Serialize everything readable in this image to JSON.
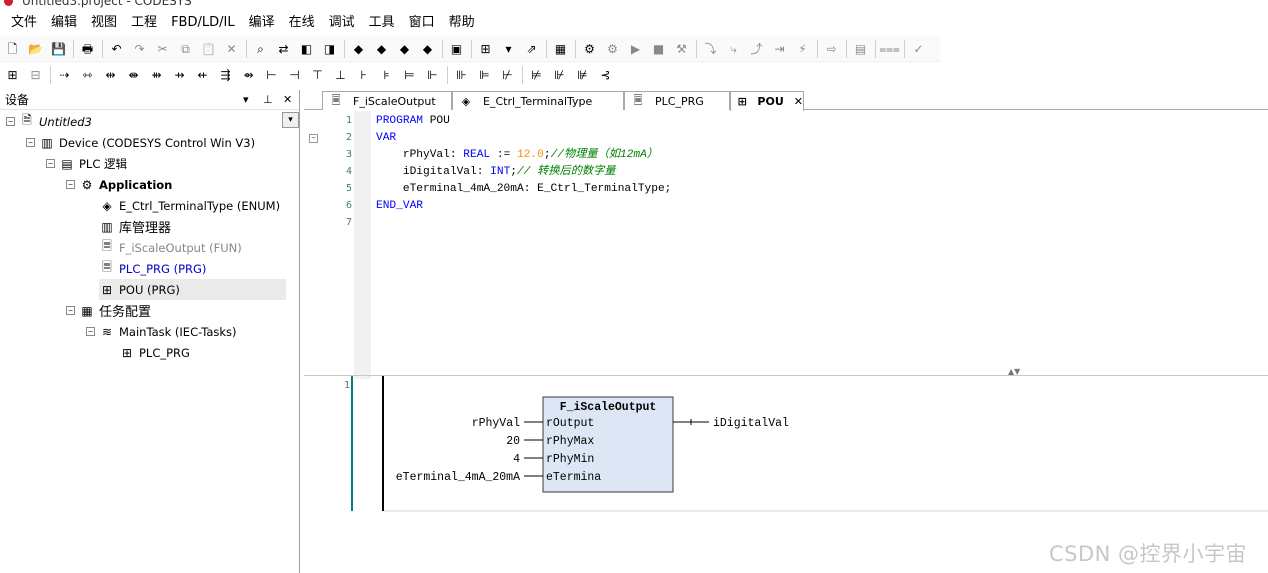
{
  "window": {
    "title": "Untitled3.project - CODESYS"
  },
  "menu": [
    "文件",
    "编辑",
    "视图",
    "工程",
    "FBD/LD/IL",
    "编译",
    "在线",
    "调试",
    "工具",
    "窗口",
    "帮助"
  ],
  "toolbar1": [
    {
      "icon": "new-file-icon",
      "glyph": "🗋"
    },
    {
      "icon": "open-folder-icon",
      "glyph": "📂"
    },
    {
      "icon": "save-icon",
      "glyph": "💾"
    },
    {
      "sep": true
    },
    {
      "icon": "print-icon",
      "glyph": "🖶"
    },
    {
      "sep": true
    },
    {
      "icon": "undo-icon",
      "glyph": "↶"
    },
    {
      "icon": "redo-icon",
      "glyph": "↷",
      "dis": true
    },
    {
      "icon": "cut-icon",
      "glyph": "✂",
      "dis": true
    },
    {
      "icon": "copy-icon",
      "glyph": "⧉",
      "dis": true
    },
    {
      "icon": "paste-icon",
      "glyph": "📋",
      "dis": true
    },
    {
      "icon": "delete-icon",
      "glyph": "✕",
      "dis": true
    },
    {
      "sep": true
    },
    {
      "icon": "find-icon",
      "glyph": "⌕"
    },
    {
      "icon": "find-replace-icon",
      "glyph": "⇄"
    },
    {
      "icon": "find-prev-icon",
      "glyph": "◧"
    },
    {
      "icon": "find-next-icon",
      "glyph": "◨"
    },
    {
      "sep": true
    },
    {
      "icon": "breakpoint-icon",
      "glyph": "◆"
    },
    {
      "icon": "breakpoint-add-icon",
      "glyph": "◆"
    },
    {
      "icon": "breakpoint-toggle-icon",
      "glyph": "◆"
    },
    {
      "icon": "breakpoint-remove-icon",
      "glyph": "◆"
    },
    {
      "sep": true
    },
    {
      "icon": "window-icon",
      "glyph": "▣"
    },
    {
      "sep": true
    },
    {
      "icon": "add-object-icon",
      "glyph": "⊞"
    },
    {
      "icon": "dropdown-icon",
      "glyph": "▾"
    },
    {
      "icon": "export-icon",
      "glyph": "⇗"
    },
    {
      "sep": true
    },
    {
      "icon": "build-icon",
      "glyph": "▦"
    },
    {
      "sep": true
    },
    {
      "icon": "login-icon",
      "glyph": "⚙"
    },
    {
      "icon": "logout-icon",
      "glyph": "⚙",
      "dis": true
    },
    {
      "icon": "start-icon",
      "glyph": "▶",
      "dis": true
    },
    {
      "icon": "stop-icon",
      "glyph": "■",
      "dis": true
    },
    {
      "icon": "reset-icon",
      "glyph": "⚒",
      "dis": true
    },
    {
      "sep": true
    },
    {
      "icon": "step-over-icon",
      "glyph": "⤵",
      "dis": true
    },
    {
      "icon": "step-into-icon",
      "glyph": "⤷",
      "dis": true
    },
    {
      "icon": "step-out-icon",
      "glyph": "⤴",
      "dis": true
    },
    {
      "icon": "run-to-cursor-icon",
      "glyph": "⇥",
      "dis": true
    },
    {
      "icon": "flow-control-icon",
      "glyph": "⚡",
      "dis": true
    },
    {
      "sep": true
    },
    {
      "icon": "next-statement-icon",
      "glyph": "⇨",
      "dis": true
    },
    {
      "sep": true
    },
    {
      "icon": "write-values-icon",
      "glyph": "▤",
      "dis": true
    },
    {
      "sep": true
    },
    {
      "icon": "force-values-icon",
      "glyph": "⩶",
      "dis": true
    },
    {
      "sep": true
    },
    {
      "icon": "unforce-icon",
      "glyph": "✓",
      "dis": true
    }
  ],
  "toolbar2": [
    {
      "icon": "insert-network-icon",
      "glyph": "⊞"
    },
    {
      "icon": "insert-network-below-icon",
      "glyph": "⊟",
      "dis": true
    },
    {
      "sep": true
    },
    {
      "icon": "insert-variable-icon",
      "glyph": "⇢"
    },
    {
      "icon": "insert-contact-icon",
      "glyph": "⇿"
    },
    {
      "icon": "insert-negated-contact-icon",
      "glyph": "⇹"
    },
    {
      "icon": "insert-parallel-icon",
      "glyph": "⇼"
    },
    {
      "icon": "insert-coil-icon",
      "glyph": "⇻"
    },
    {
      "icon": "insert-set-coil-icon",
      "glyph": "⇸"
    },
    {
      "icon": "insert-reset-coil-icon",
      "glyph": "⇷"
    },
    {
      "icon": "insert-box-icon",
      "glyph": "⇶"
    },
    {
      "icon": "insert-empty-box-icon",
      "glyph": "⇴"
    },
    {
      "icon": "insert-input-icon",
      "glyph": "⊢"
    },
    {
      "icon": "insert-output-icon",
      "glyph": "⊣"
    },
    {
      "icon": "insert-assignment-icon",
      "glyph": "⊤"
    },
    {
      "icon": "insert-jump-icon",
      "glyph": "⊥"
    },
    {
      "icon": "insert-label-icon",
      "glyph": "⊦"
    },
    {
      "icon": "insert-return-icon",
      "glyph": "⊧"
    },
    {
      "icon": "insert-branch-icon",
      "glyph": "⊨"
    },
    {
      "icon": "set-output-icon",
      "glyph": "⊩"
    },
    {
      "sep": true
    },
    {
      "icon": "negate-icon",
      "glyph": "⊪"
    },
    {
      "icon": "edge-detect-icon",
      "glyph": "⊫"
    },
    {
      "icon": "set-reset-icon",
      "glyph": "⊬"
    },
    {
      "sep": true
    },
    {
      "icon": "align-left-icon",
      "glyph": "⊭"
    },
    {
      "icon": "align-top-icon",
      "glyph": "⊮"
    },
    {
      "icon": "update-params-icon",
      "glyph": "⊯"
    },
    {
      "icon": "remove-unused-icon",
      "glyph": "⊰"
    }
  ],
  "devices": {
    "title": "设备",
    "pin": "⊥",
    "close": "✕",
    "dropdown": "▾",
    "tree": [
      {
        "label": "Untitled3",
        "icon": "project-icon",
        "glyph": "🗎",
        "exp": "−",
        "level": 0,
        "italic": true
      },
      {
        "label": "Device (CODESYS Control Win V3)",
        "icon": "device-icon",
        "glyph": "▥",
        "exp": "−",
        "level": 1
      },
      {
        "label": "PLC 逻辑",
        "icon": "plc-logic-icon",
        "glyph": "▤",
        "exp": "−",
        "level": 2
      },
      {
        "label": "Application",
        "icon": "application-gear-icon",
        "glyph": "⚙",
        "exp": "−",
        "level": 3,
        "bold": true
      },
      {
        "label": "E_Ctrl_TerminalType (ENUM)",
        "icon": "enum-icon",
        "glyph": "◈",
        "level": 4
      },
      {
        "label": "库管理器",
        "icon": "library-manager-icon",
        "glyph": "▥",
        "level": 4,
        "big": true
      },
      {
        "label": "F_iScaleOutput (FUN)",
        "icon": "function-icon",
        "glyph": "🗏",
        "level": 4,
        "color": "#888888"
      },
      {
        "label": "PLC_PRG (PRG)",
        "icon": "program-icon",
        "glyph": "🗏",
        "level": 4,
        "color": "#0000cc"
      },
      {
        "label": "POU (PRG)",
        "icon": "pou-fbd-icon",
        "glyph": "⊞",
        "level": 4,
        "selected": true
      },
      {
        "label": "任务配置",
        "icon": "task-config-icon",
        "glyph": "▦",
        "exp": "−",
        "level": 3,
        "big": true
      },
      {
        "label": "MainTask (IEC-Tasks)",
        "icon": "task-icon",
        "glyph": "≋",
        "exp": "−",
        "level": 4
      },
      {
        "label": "PLC_PRG",
        "icon": "program-call-icon",
        "glyph": "⊞",
        "level": 5
      }
    ]
  },
  "tabs": [
    {
      "label": "F_iScaleOutput",
      "icon": "function-icon",
      "glyph": "🗏"
    },
    {
      "label": "E_Ctrl_TerminalType",
      "icon": "enum-icon",
      "glyph": "◈"
    },
    {
      "label": "PLC_PRG",
      "icon": "program-icon",
      "glyph": "🗏"
    },
    {
      "label": "POU",
      "icon": "pou-fbd-icon",
      "glyph": "⊞",
      "active": true,
      "close": "✕"
    }
  ],
  "declaration": {
    "line_numbers": [
      "1",
      "2",
      "3",
      "4",
      "5",
      "6",
      "7"
    ],
    "fold_markers": [
      "−"
    ]
  },
  "code": {
    "l1_kw": "PROGRAM",
    "l1_rest": " POU",
    "l2_kw": "VAR",
    "l3_a": "    rPhyVal: ",
    "l3_type": "REAL",
    "l3_b": " := ",
    "l3_num": "12.0",
    "l3_c": ";",
    "l3_cm": "//物理量（如12mA）",
    "l4_a": "    iDigitalVal: ",
    "l4_type": "INT",
    "l4_b": ";",
    "l4_cm": "// 转换后的数字量",
    "l5_a": "    eTerminal_4mA_20mA: E_Ctrl_TerminalType;",
    "l6_kw": "END_VAR"
  },
  "fbd": {
    "network_number": "1",
    "block_name": "F_iScaleOutput",
    "output_pin": "rOutput",
    "pins": [
      "rPhyMax",
      "rPhyMin",
      "eTermina"
    ],
    "inputs": [
      "rPhyVal",
      "20",
      "4",
      "eTerminal_4mA_20mA"
    ],
    "output_var": "iDigitalVal"
  },
  "splitter_arrows": "▲▼",
  "watermark": "CSDN @控界小宇宙",
  "colors": {
    "keyword": "#0000ff",
    "number": "#ff8c00",
    "comment": "#008000",
    "block_fill": "#dce6f4",
    "block_border": "#3a3a3a",
    "network_rail": "#008080"
  }
}
